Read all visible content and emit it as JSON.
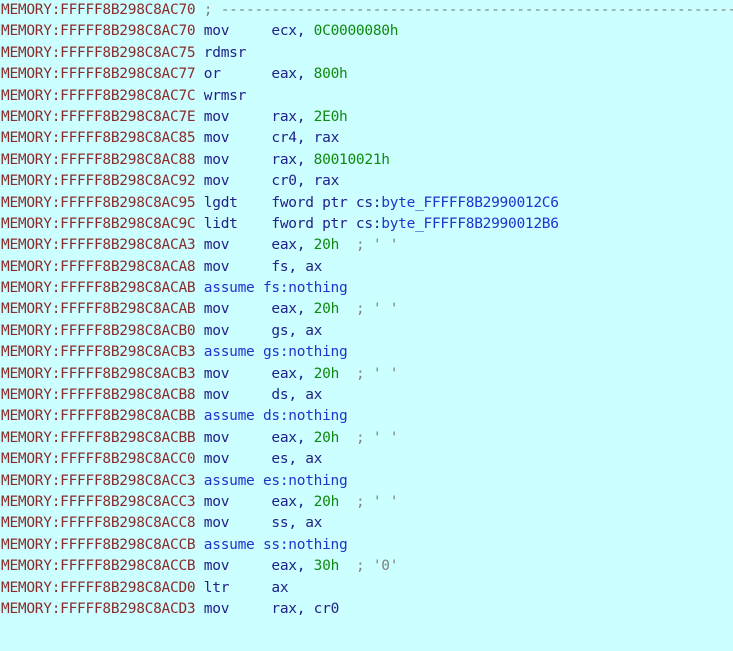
{
  "view": {
    "name": "IDA Pro disassembly listing",
    "segment": "MEMORY",
    "background_color": "#ccffff",
    "colors": {
      "address": "#8b2b2b",
      "mnemonic": "#21218a",
      "register": "#21218a",
      "number": "#0e8a0e",
      "directive": "#2233cc",
      "symbol": "#2233cc",
      "comment": "#7f7f7f"
    }
  },
  "lines": [
    {
      "prefix": "MEMORY:FFFFF8B298C8AC70",
      "kind": "comment",
      "mnemonic": "",
      "comment": "; ------------------------------------------------------------------"
    },
    {
      "prefix": "MEMORY:FFFFF8B298C8AC70",
      "kind": "insn",
      "mnemonic": "mov",
      "dest": "ecx",
      "sep": ", ",
      "imm": "0C0000080h",
      "comment": ""
    },
    {
      "prefix": "MEMORY:FFFFF8B298C8AC75",
      "kind": "insn",
      "mnemonic": "rdmsr",
      "dest": "",
      "sep": "",
      "imm": "",
      "comment": ""
    },
    {
      "prefix": "MEMORY:FFFFF8B298C8AC77",
      "kind": "insn",
      "mnemonic": "or",
      "dest": "eax",
      "sep": ", ",
      "imm": "800h",
      "comment": ""
    },
    {
      "prefix": "MEMORY:FFFFF8B298C8AC7C",
      "kind": "insn",
      "mnemonic": "wrmsr",
      "dest": "",
      "sep": "",
      "imm": "",
      "comment": ""
    },
    {
      "prefix": "MEMORY:FFFFF8B298C8AC7E",
      "kind": "insn",
      "mnemonic": "mov",
      "dest": "rax",
      "sep": ", ",
      "imm": "2E0h",
      "comment": ""
    },
    {
      "prefix": "MEMORY:FFFFF8B298C8AC85",
      "kind": "insn",
      "mnemonic": "mov",
      "dest": "cr4",
      "sep": ", ",
      "src": "rax",
      "comment": ""
    },
    {
      "prefix": "MEMORY:FFFFF8B298C8AC88",
      "kind": "insn",
      "mnemonic": "mov",
      "dest": "rax",
      "sep": ", ",
      "imm": "80010021h",
      "comment": ""
    },
    {
      "prefix": "MEMORY:FFFFF8B298C8AC92",
      "kind": "insn",
      "mnemonic": "mov",
      "dest": "cr0",
      "sep": ", ",
      "src": "rax",
      "comment": ""
    },
    {
      "prefix": "MEMORY:FFFFF8B298C8AC95",
      "kind": "mem",
      "mnemonic": "lgdt",
      "memprefix": "fword ptr cs:",
      "symbol": "byte_FFFFF8B2990012C6",
      "comment": ""
    },
    {
      "prefix": "MEMORY:FFFFF8B298C8AC9C",
      "kind": "mem",
      "mnemonic": "lidt",
      "memprefix": "fword ptr cs:",
      "symbol": "byte_FFFFF8B2990012B6",
      "comment": ""
    },
    {
      "prefix": "MEMORY:FFFFF8B298C8ACA3",
      "kind": "insn",
      "mnemonic": "mov",
      "dest": "eax",
      "sep": ", ",
      "imm": "20h",
      "comment": "; ' '"
    },
    {
      "prefix": "MEMORY:FFFFF8B298C8ACA8",
      "kind": "insn",
      "mnemonic": "mov",
      "dest": "fs",
      "sep": ", ",
      "src": "ax",
      "comment": ""
    },
    {
      "prefix": "MEMORY:FFFFF8B298C8ACAB",
      "kind": "assume",
      "mnemonic": "assume",
      "directive": "assume fs:nothing",
      "comment": ""
    },
    {
      "prefix": "MEMORY:FFFFF8B298C8ACAB",
      "kind": "insn",
      "mnemonic": "mov",
      "dest": "eax",
      "sep": ", ",
      "imm": "20h",
      "comment": "; ' '"
    },
    {
      "prefix": "MEMORY:FFFFF8B298C8ACB0",
      "kind": "insn",
      "mnemonic": "mov",
      "dest": "gs",
      "sep": ", ",
      "src": "ax",
      "comment": ""
    },
    {
      "prefix": "MEMORY:FFFFF8B298C8ACB3",
      "kind": "assume",
      "mnemonic": "assume",
      "directive": "assume gs:nothing",
      "comment": ""
    },
    {
      "prefix": "MEMORY:FFFFF8B298C8ACB3",
      "kind": "insn",
      "mnemonic": "mov",
      "dest": "eax",
      "sep": ", ",
      "imm": "20h",
      "comment": "; ' '"
    },
    {
      "prefix": "MEMORY:FFFFF8B298C8ACB8",
      "kind": "insn",
      "mnemonic": "mov",
      "dest": "ds",
      "sep": ", ",
      "src": "ax",
      "comment": ""
    },
    {
      "prefix": "MEMORY:FFFFF8B298C8ACBB",
      "kind": "assume",
      "mnemonic": "assume",
      "directive": "assume ds:nothing",
      "comment": ""
    },
    {
      "prefix": "MEMORY:FFFFF8B298C8ACBB",
      "kind": "insn",
      "mnemonic": "mov",
      "dest": "eax",
      "sep": ", ",
      "imm": "20h",
      "comment": "; ' '"
    },
    {
      "prefix": "MEMORY:FFFFF8B298C8ACC0",
      "kind": "insn",
      "mnemonic": "mov",
      "dest": "es",
      "sep": ", ",
      "src": "ax",
      "comment": ""
    },
    {
      "prefix": "MEMORY:FFFFF8B298C8ACC3",
      "kind": "assume",
      "mnemonic": "assume",
      "directive": "assume es:nothing",
      "comment": ""
    },
    {
      "prefix": "MEMORY:FFFFF8B298C8ACC3",
      "kind": "insn",
      "mnemonic": "mov",
      "dest": "eax",
      "sep": ", ",
      "imm": "20h",
      "comment": "; ' '"
    },
    {
      "prefix": "MEMORY:FFFFF8B298C8ACC8",
      "kind": "insn",
      "mnemonic": "mov",
      "dest": "ss",
      "sep": ", ",
      "src": "ax",
      "comment": ""
    },
    {
      "prefix": "MEMORY:FFFFF8B298C8ACCB",
      "kind": "assume",
      "mnemonic": "assume",
      "directive": "assume ss:nothing",
      "comment": ""
    },
    {
      "prefix": "MEMORY:FFFFF8B298C8ACCB",
      "kind": "insn",
      "mnemonic": "mov",
      "dest": "eax",
      "sep": ", ",
      "imm": "30h",
      "comment": "; '0'"
    },
    {
      "prefix": "MEMORY:FFFFF8B298C8ACD0",
      "kind": "insn",
      "mnemonic": "ltr",
      "dest": "ax",
      "sep": "",
      "src": "",
      "comment": ""
    },
    {
      "prefix": "MEMORY:FFFFF8B298C8ACD3",
      "kind": "insn",
      "mnemonic": "mov",
      "dest": "rax",
      "sep": ", ",
      "src": "cr0",
      "comment": ""
    }
  ]
}
